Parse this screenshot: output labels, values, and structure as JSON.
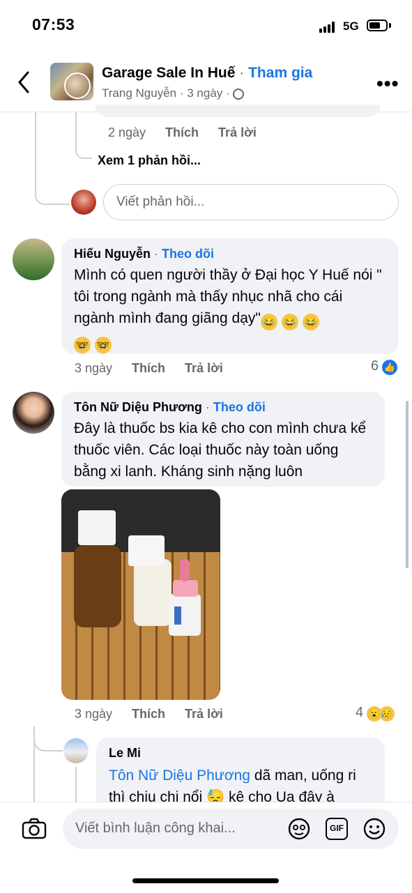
{
  "status": {
    "time": "07:53",
    "network": "5G"
  },
  "header": {
    "group_name": "Garage Sale In Huế",
    "separator": "·",
    "join_label": "Tham gia",
    "poster": "Trang Nguyễn",
    "time": "3 ngày",
    "icons": [
      "back-chevron-icon",
      "globe-icon",
      "more-icon"
    ]
  },
  "prev_thread": {
    "meta_time": "2 ngày",
    "like": "Thích",
    "reply": "Trả lời",
    "see_replies": "Xem 1 phản hồi...",
    "reply_placeholder": "Viết phản hồi..."
  },
  "comments": [
    {
      "name": "Hiếu Nguyễn",
      "follow": "Theo dõi",
      "text": "Mình có quen người thầy ở Đại học Y Huế nói \" tôi trong ngành mà thấy nhục nhã cho cái ngành mình đang giãng dạy\"",
      "emojis": [
        "😂",
        "😂",
        "😂",
        "🤓",
        "🤓"
      ],
      "time": "3 ngày",
      "like": "Thích",
      "reply": "Trả lời",
      "reaction_count": "6"
    },
    {
      "name": "Tôn Nữ Diệu Phương",
      "follow": "Theo dõi",
      "text": "Đây là thuốc bs kia kê cho con mình chưa kể thuốc viên. Các loại thuốc này toàn uống bằng xi lanh. Kháng sinh nặng luôn",
      "time": "3 ngày",
      "like": "Thích",
      "reply": "Trả lời",
      "reaction_count": "4"
    }
  ],
  "nested_reply": {
    "name": "Le Mi",
    "mention": "Tôn Nữ Diệu Phương",
    "text": " dã man, uống ri thì chịu chi nổi 😓 kê cho Ua đây à"
  },
  "composer": {
    "placeholder": "Viết bình luận công khai...",
    "gif_label": "GIF"
  },
  "colors": {
    "accent": "#1b74e4",
    "bubble": "#f0f2f5",
    "muted": "#65676b"
  }
}
